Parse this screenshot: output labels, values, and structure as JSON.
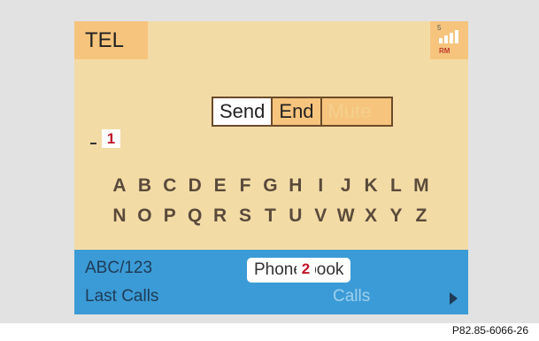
{
  "header": {
    "title": "TEL",
    "signal_number": "5",
    "roaming_label": "RM"
  },
  "call_controls": {
    "send_label": "Send",
    "end_label": "End",
    "mute_label": "Mute"
  },
  "markers": {
    "marker_1": "1",
    "marker_2": "2"
  },
  "keyboard": {
    "row1": [
      "A",
      "B",
      "C",
      "D",
      "E",
      "F",
      "G",
      "H",
      "I",
      "J",
      "K",
      "L",
      "M"
    ],
    "row2": [
      "N",
      "O",
      "P",
      "Q",
      "R",
      "S",
      "T",
      "U",
      "V",
      "W",
      "X",
      "Y",
      "Z"
    ]
  },
  "menu": {
    "abc_label": "ABC/123",
    "last_calls_label": "Last Calls",
    "phone_book_label": "Phone book",
    "calls_label": "Calls"
  },
  "caption": "P82.85-6066-26",
  "colors": {
    "screen_bg": "#f3dba6",
    "tab_bg": "#f6c47d",
    "bottom_bar": "#3b9bd6",
    "marker_text": "#c0152a"
  }
}
